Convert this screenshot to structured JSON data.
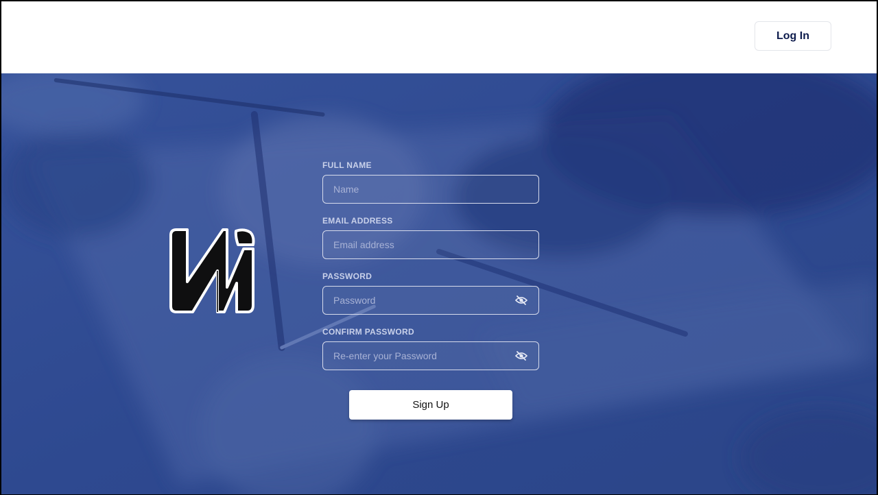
{
  "header": {
    "login_label": "Log In"
  },
  "form": {
    "full_name": {
      "label": "FULL NAME",
      "placeholder": "Name"
    },
    "email": {
      "label": "EMAIL ADDRESS",
      "placeholder": "Email address"
    },
    "password": {
      "label": "PASSWORD",
      "placeholder": "Password"
    },
    "confirm_password": {
      "label": "CONFIRM PASSWORD",
      "placeholder": "Re-enter your Password"
    },
    "submit_label": "Sign Up"
  },
  "colors": {
    "hero_overlay": "#2f4a8f",
    "brand_navy": "#0d1b4c"
  },
  "icons": {
    "logo": "wm-logo",
    "password_toggle": "eye-slash-icon"
  }
}
